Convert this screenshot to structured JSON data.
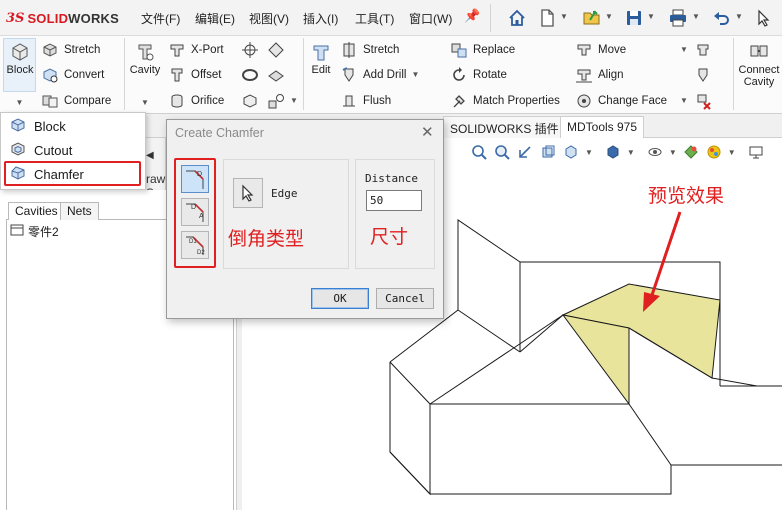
{
  "app": {
    "logo_mark": "3S",
    "logo_text": "SOLIDWORKS",
    "logo_ds": "DS",
    "logo_solid": "SOLID",
    "logo_works": "WORKS"
  },
  "menu": [
    {
      "label": "文件(F)"
    },
    {
      "label": "编辑(E)"
    },
    {
      "label": "视图(V)"
    },
    {
      "label": "插入(I)"
    },
    {
      "label": "工具(T)"
    },
    {
      "label": "窗口(W)"
    }
  ],
  "toolbar_icons": [
    "home-icon",
    "new-document-icon",
    "open-icon",
    "save-icon",
    "print-icon",
    "undo-icon",
    "pin-icon"
  ],
  "ribbon": {
    "block": "Block",
    "stretch": "Stretch",
    "convert": "Convert",
    "compare": "Compare",
    "cavity": "Cavity",
    "xport": "X-Port",
    "offset": "Offset",
    "orifice": "Orifice",
    "edit": "Edit",
    "stretch2": "Stretch",
    "add_drill": "Add Drill",
    "flush": "Flush",
    "replace": "Replace",
    "rotate": "Rotate",
    "match_properties": "Match Properties",
    "move": "Move",
    "align": "Align",
    "change_face": "Change Face",
    "connect_cavity": "Connect Cavity"
  },
  "block_menu": {
    "items": [
      {
        "label": "Block"
      },
      {
        "label": "Cutout"
      },
      {
        "label": "Chamfer"
      }
    ]
  },
  "tabs": [
    {
      "label": "SOLIDWORKS 插件"
    },
    {
      "label": "MDTools 975"
    }
  ],
  "left_panel": {
    "tabs": [
      {
        "label": "Cavities"
      },
      {
        "label": "Nets"
      }
    ],
    "tree_item": "零件2",
    "draw_fragment": "raw S"
  },
  "dialog": {
    "title": "Create Chamfer",
    "edge_label": "Edge",
    "distance_label": "Distance",
    "distance_value": "50",
    "ok": "OK",
    "cancel": "Cancel",
    "type_buttons": [
      {
        "glyph": "D"
      },
      {
        "glyph": "A"
      },
      {
        "glyph": "D1 D2"
      }
    ]
  },
  "annotations": {
    "chamfer_type": "倒角类型",
    "size": "尺寸",
    "preview": "预览效果"
  },
  "colors": {
    "accent_red": "#e02020",
    "logo_red": "#d71920",
    "chamfer_fill": "#e8e49c",
    "selected_blue": "#cde3f7"
  }
}
